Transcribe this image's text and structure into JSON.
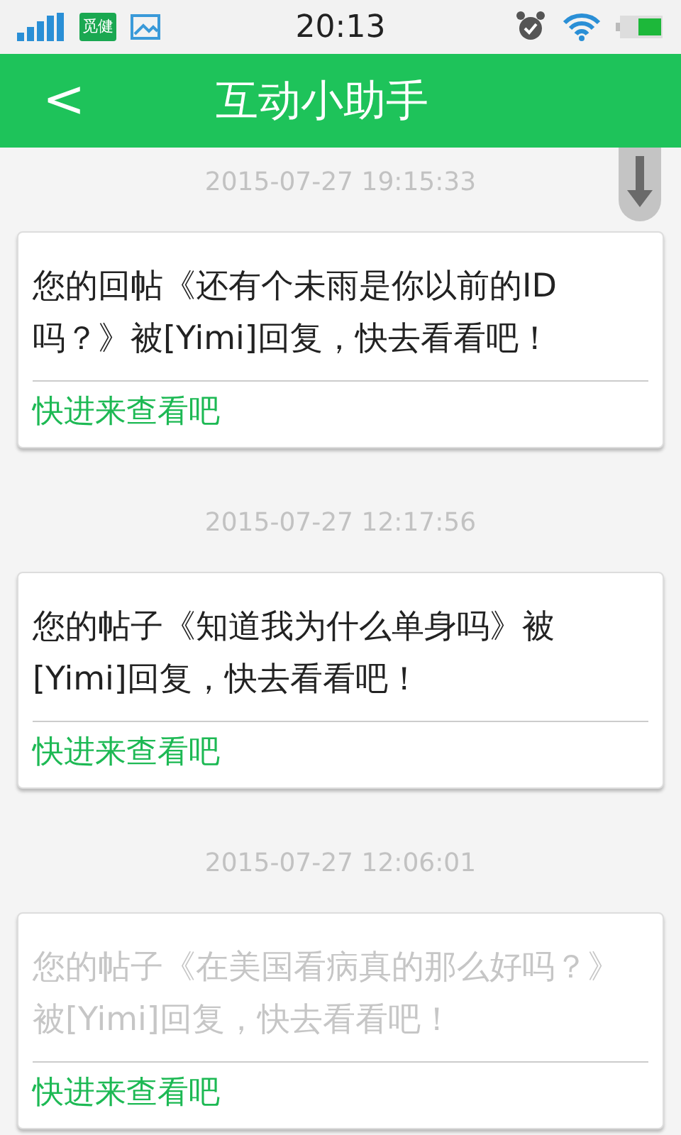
{
  "status_bar": {
    "app_badge": "觅健",
    "time": "20:13"
  },
  "header": {
    "back": "<",
    "title": "互动小助手"
  },
  "messages": [
    {
      "time": "2015-07-27 19:15:33",
      "text": "您的回帖《还有个未雨是你以前的ID吗？》被[Yimi]回复，快去看看吧！",
      "link": "快进来查看吧",
      "read": false
    },
    {
      "time": "2015-07-27 12:17:56",
      "text": "您的帖子《知道我为什么单身吗》被[Yimi]回复，快去看看吧！",
      "link": "快进来查看吧",
      "read": false
    },
    {
      "time": "2015-07-27 12:06:01",
      "text": "您的帖子《在美国看病真的那么好吗？》被[Yimi]回复，快去看看吧！",
      "link": "快进来查看吧",
      "read": true
    }
  ]
}
